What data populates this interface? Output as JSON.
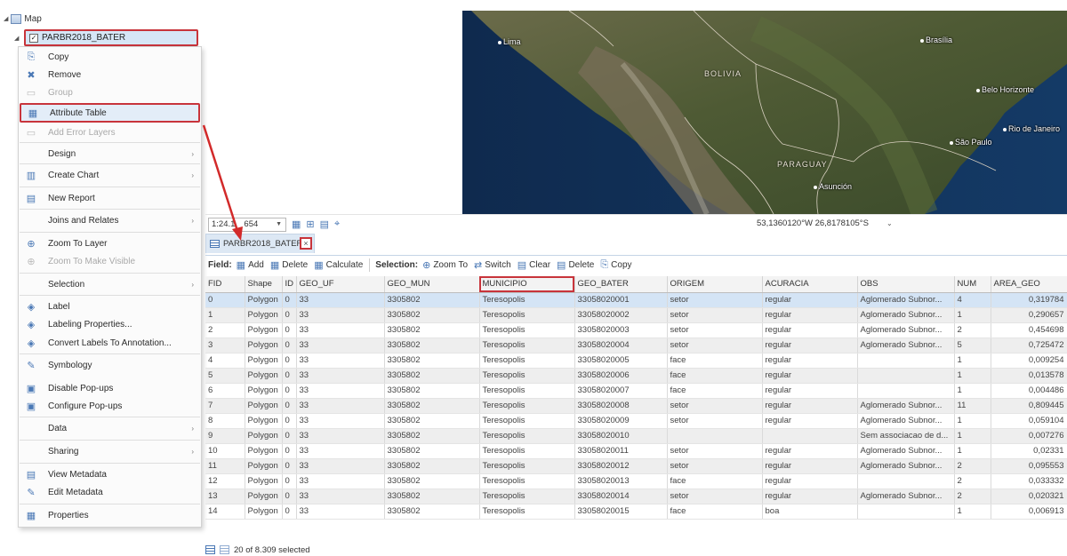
{
  "contents_pane": {
    "map_label": "Map",
    "layer_name": "PARBR2018_BATER"
  },
  "context_menu": {
    "items": [
      {
        "label": "Copy",
        "icon": "copy-icon",
        "glyph": "⎘",
        "disabled": false,
        "submenu": false
      },
      {
        "label": "Remove",
        "icon": "remove-icon",
        "glyph": "✖",
        "disabled": false,
        "submenu": false
      },
      {
        "label": "Group",
        "icon": "group-icon",
        "glyph": "▭",
        "disabled": true,
        "submenu": false
      },
      {
        "label": "Attribute Table",
        "icon": "attribute-table-icon",
        "glyph": "▦",
        "disabled": false,
        "submenu": false
      },
      {
        "label": "Add Error Layers",
        "icon": "add-error-layers-icon",
        "glyph": "▭",
        "disabled": true,
        "submenu": false
      },
      {
        "label": "Design",
        "icon": "",
        "glyph": "",
        "disabled": false,
        "submenu": true
      },
      {
        "label": "Create Chart",
        "icon": "chart-icon",
        "glyph": "▥",
        "disabled": false,
        "submenu": true
      },
      {
        "label": "New Report",
        "icon": "report-icon",
        "glyph": "▤",
        "disabled": false,
        "submenu": false
      },
      {
        "label": "Joins and Relates",
        "icon": "",
        "glyph": "",
        "disabled": false,
        "submenu": true
      },
      {
        "label": "Zoom To Layer",
        "icon": "zoom-to-layer-icon",
        "glyph": "⊕",
        "disabled": false,
        "submenu": false
      },
      {
        "label": "Zoom To Make Visible",
        "icon": "zoom-to-visible-icon",
        "glyph": "⊕",
        "disabled": true,
        "submenu": false
      },
      {
        "label": "Selection",
        "icon": "",
        "glyph": "",
        "disabled": false,
        "submenu": true
      },
      {
        "label": "Label",
        "icon": "label-icon",
        "glyph": "◈",
        "disabled": false,
        "submenu": false
      },
      {
        "label": "Labeling Properties...",
        "icon": "labeling-properties-icon",
        "glyph": "◈",
        "disabled": false,
        "submenu": false
      },
      {
        "label": "Convert Labels To Annotation...",
        "icon": "convert-labels-icon",
        "glyph": "◈",
        "disabled": false,
        "submenu": false
      },
      {
        "label": "Symbology",
        "icon": "symbology-icon",
        "glyph": "✎",
        "disabled": false,
        "submenu": false
      },
      {
        "label": "Disable Pop-ups",
        "icon": "disable-popups-icon",
        "glyph": "▣",
        "disabled": false,
        "submenu": false
      },
      {
        "label": "Configure Pop-ups",
        "icon": "configure-popups-icon",
        "glyph": "▣",
        "disabled": false,
        "submenu": false
      },
      {
        "label": "Data",
        "icon": "",
        "glyph": "",
        "disabled": false,
        "submenu": true
      },
      {
        "label": "Sharing",
        "icon": "",
        "glyph": "",
        "disabled": false,
        "submenu": true
      },
      {
        "label": "View Metadata",
        "icon": "view-metadata-icon",
        "glyph": "▤",
        "disabled": false,
        "submenu": false
      },
      {
        "label": "Edit Metadata",
        "icon": "edit-metadata-icon",
        "glyph": "✎",
        "disabled": false,
        "submenu": false
      },
      {
        "label": "Properties",
        "icon": "properties-icon",
        "glyph": "▦",
        "disabled": false,
        "submenu": false
      }
    ]
  },
  "map": {
    "country_labels": [
      "BOLIVIA",
      "PARAGUAY"
    ],
    "city_labels": [
      "Lima",
      "Brasília",
      "Belo Horizonte",
      "Rio de Janeiro",
      "São Paulo",
      "Asunción"
    ]
  },
  "map_status": {
    "scale": "1:24.1",
    "scale_suffix": "654",
    "coordinates": "53,1360120°W 26,8178105°S"
  },
  "table_tab": {
    "title": "PARBR2018_BATER",
    "close_label": "×"
  },
  "table_toolbar": {
    "field_label": "Field:",
    "field_buttons": [
      "Add",
      "Delete",
      "Calculate"
    ],
    "selection_label": "Selection:",
    "selection_buttons": [
      "Zoom To",
      "Switch",
      "Clear",
      "Delete",
      "Copy"
    ]
  },
  "attribute_table": {
    "columns": [
      "FID",
      "Shape",
      "ID",
      "GEO_UF",
      "GEO_MUN",
      "MUNICIPIO",
      "GEO_BATER",
      "ORIGEM",
      "ACURACIA",
      "OBS",
      "NUM",
      "AREA_GEO"
    ],
    "rows": [
      [
        "0",
        "Polygon",
        "0",
        "33",
        "3305802",
        "Teresopolis",
        "33058020001",
        "setor",
        "regular",
        "Aglomerado Subnor...",
        "4",
        "0,319784"
      ],
      [
        "1",
        "Polygon",
        "0",
        "33",
        "3305802",
        "Teresopolis",
        "33058020002",
        "setor",
        "regular",
        "Aglomerado Subnor...",
        "1",
        "0,290657"
      ],
      [
        "2",
        "Polygon",
        "0",
        "33",
        "3305802",
        "Teresopolis",
        "33058020003",
        "setor",
        "regular",
        "Aglomerado Subnor...",
        "2",
        "0,454698"
      ],
      [
        "3",
        "Polygon",
        "0",
        "33",
        "3305802",
        "Teresopolis",
        "33058020004",
        "setor",
        "regular",
        "Aglomerado Subnor...",
        "5",
        "0,725472"
      ],
      [
        "4",
        "Polygon",
        "0",
        "33",
        "3305802",
        "Teresopolis",
        "33058020005",
        "face",
        "regular",
        "",
        "1",
        "0,009254"
      ],
      [
        "5",
        "Polygon",
        "0",
        "33",
        "3305802",
        "Teresopolis",
        "33058020006",
        "face",
        "regular",
        "",
        "1",
        "0,013578"
      ],
      [
        "6",
        "Polygon",
        "0",
        "33",
        "3305802",
        "Teresopolis",
        "33058020007",
        "face",
        "regular",
        "",
        "1",
        "0,004486"
      ],
      [
        "7",
        "Polygon",
        "0",
        "33",
        "3305802",
        "Teresopolis",
        "33058020008",
        "setor",
        "regular",
        "Aglomerado Subnor...",
        "11",
        "0,809445"
      ],
      [
        "8",
        "Polygon",
        "0",
        "33",
        "3305802",
        "Teresopolis",
        "33058020009",
        "setor",
        "regular",
        "Aglomerado Subnor...",
        "1",
        "0,059104"
      ],
      [
        "9",
        "Polygon",
        "0",
        "33",
        "3305802",
        "Teresopolis",
        "33058020010",
        "",
        "",
        "Sem associacao de d...",
        "1",
        "0,007276"
      ],
      [
        "10",
        "Polygon",
        "0",
        "33",
        "3305802",
        "Teresopolis",
        "33058020011",
        "setor",
        "regular",
        "Aglomerado Subnor...",
        "1",
        "0,02331"
      ],
      [
        "11",
        "Polygon",
        "0",
        "33",
        "3305802",
        "Teresopolis",
        "33058020012",
        "setor",
        "regular",
        "Aglomerado Subnor...",
        "2",
        "0,095553"
      ],
      [
        "12",
        "Polygon",
        "0",
        "33",
        "3305802",
        "Teresopolis",
        "33058020013",
        "face",
        "regular",
        "",
        "2",
        "0,033332"
      ],
      [
        "13",
        "Polygon",
        "0",
        "33",
        "3305802",
        "Teresopolis",
        "33058020014",
        "setor",
        "regular",
        "Aglomerado Subnor...",
        "2",
        "0,020321"
      ],
      [
        "14",
        "Polygon",
        "0",
        "33",
        "3305802",
        "Teresopolis",
        "33058020015",
        "face",
        "boa",
        "",
        "1",
        "0,006913"
      ]
    ],
    "selection_status": "20 of 8.309 selected"
  },
  "colors": {
    "highlight_red": "#c8343b",
    "selection_blue": "#d4e4f5",
    "accent_blue": "#4a78b5"
  }
}
